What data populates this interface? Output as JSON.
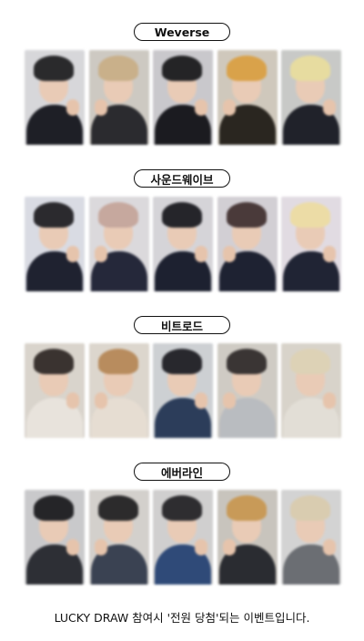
{
  "sections": [
    {
      "label": "Weverse",
      "cards": [
        {
          "bg": "#d7d7da",
          "hair": "#2a2a2c",
          "body": "#1e1f26"
        },
        {
          "bg": "#cdc9c2",
          "hair": "#c9b08a",
          "body": "#2b2b2f"
        },
        {
          "bg": "#c9c8cc",
          "hair": "#242426",
          "body": "#1b1b20"
        },
        {
          "bg": "#cfc8bc",
          "hair": "#d9a24a",
          "body": "#2a2620"
        },
        {
          "bg": "#c8c9c7",
          "hair": "#e7dca0",
          "body": "#20222a"
        }
      ]
    },
    {
      "label": "사운드웨이브",
      "cards": [
        {
          "bg": "#d9dbe3",
          "hair": "#2b2a2e",
          "body": "#1f2230"
        },
        {
          "bg": "#dbd9dc",
          "hair": "#c6a89e",
          "body": "#25283a"
        },
        {
          "bg": "#d5d4d8",
          "hair": "#25252a",
          "body": "#1d2130"
        },
        {
          "bg": "#d2cfd4",
          "hair": "#4a3a3a",
          "body": "#1e2232"
        },
        {
          "bg": "#e1dbe2",
          "hair": "#ecdca6",
          "body": "#202434"
        }
      ]
    },
    {
      "label": "비트로드",
      "cards": [
        {
          "bg": "#d9d4cc",
          "hair": "#3a3330",
          "body": "#e8e3dc"
        },
        {
          "bg": "#dcd6cd",
          "hair": "#b88c5e",
          "body": "#e6ddd2"
        },
        {
          "bg": "#cdd0d3",
          "hair": "#28282d",
          "body": "#2c3d5a"
        },
        {
          "bg": "#cfcbc4",
          "hair": "#3a3534",
          "body": "#b9bcc0"
        },
        {
          "bg": "#d8d3ca",
          "hair": "#ddd2b6",
          "body": "#e2ded6"
        }
      ]
    },
    {
      "label": "에버라인",
      "cards": [
        {
          "bg": "#c9c9cb",
          "hair": "#252528",
          "body": "#2d2f35"
        },
        {
          "bg": "#d3d0cc",
          "hair": "#2c2b2c",
          "body": "#3a4252"
        },
        {
          "bg": "#d0cfcf",
          "hair": "#2e2d30",
          "body": "#2f4a78"
        },
        {
          "bg": "#c8c4bd",
          "hair": "#c89a58",
          "body": "#2a2c31"
        },
        {
          "bg": "#d3d3d3",
          "hair": "#d9ccb0",
          "body": "#6b6e73"
        }
      ]
    }
  ],
  "footer": "LUCKY DRAW 참여시 '전원 당첨'되는 이벤트입니다."
}
